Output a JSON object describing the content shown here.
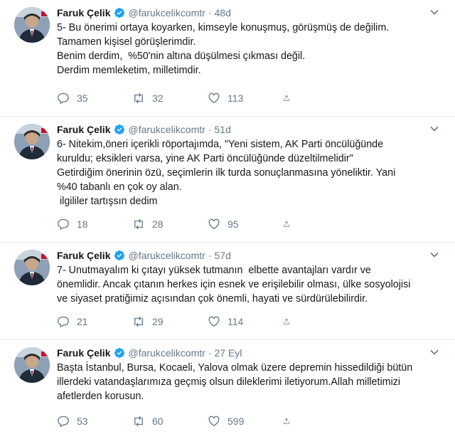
{
  "tweets": [
    {
      "name": "Faruk Çelik",
      "handle": "@farukcelikcomtr",
      "separator": "·",
      "time": "48d",
      "text": "5- Bu önerimi ortaya koyarken, kimseyle konuşmuş, görüşmüş de değilim.\nTamamen kişisel görüşlerimdir.\nBenim derdim,  %50'nin altına düşülmesi çıkması değil.\nDerdim memleketim, milletimdir.",
      "replies": "35",
      "retweets": "32",
      "likes": "113"
    },
    {
      "name": "Faruk Çelik",
      "handle": "@farukcelikcomtr",
      "separator": "·",
      "time": "51d",
      "text": "6- Nitekim,öneri içerikli röportajımda, \"Yeni sistem, AK Parti öncülüğünde\nkuruldu; eksikleri varsa, yine AK Parti öncülüğünde düzeltilmelidir\"\nGetirdiğim önerinin özü, seçimlerin ilk turda sonuçlanmasına yöneliktir. Yani\n%40 tabanlı en çok oy alan.\n ilgililer tartışsın dedim",
      "replies": "18",
      "retweets": "28",
      "likes": "95"
    },
    {
      "name": "Faruk Çelik",
      "handle": "@farukcelikcomtr",
      "separator": "·",
      "time": "57d",
      "text": "7- Unutmayalım ki çıtayı yüksek tutmanın  elbette avantajları vardır ve\nönemlidir. Ancak çıtanın herkes için esnek ve erişilebilir olması, ülke sosyolojisi\nve siyaset pratiğimiz açısından çok önemli, hayati ve sürdürülebilirdir.",
      "replies": "21",
      "retweets": "29",
      "likes": "114"
    },
    {
      "name": "Faruk Çelik",
      "handle": "@farukcelikcomtr",
      "separator": "·",
      "time": "27 Eyl",
      "text": "Başta İstanbul, Bursa, Kocaeli, Yalova olmak üzere depremin hissedildiği bütün\nillerdeki vatandaşlarımıza geçmiş olsun dileklerimi iletiyorum.Allah milletimizi\nafetlerden korusun.",
      "replies": "53",
      "retweets": "60",
      "likes": "599"
    }
  ],
  "icons": {
    "verified": "verified-badge-icon",
    "caret": "chevron-down-icon",
    "reply": "reply-icon",
    "retweet": "retweet-icon",
    "like": "heart-icon",
    "share": "share-icon"
  },
  "colors": {
    "verified": "#1da1f2",
    "muted": "#657786",
    "text": "#14171a",
    "divider": "#e6ecf0"
  }
}
